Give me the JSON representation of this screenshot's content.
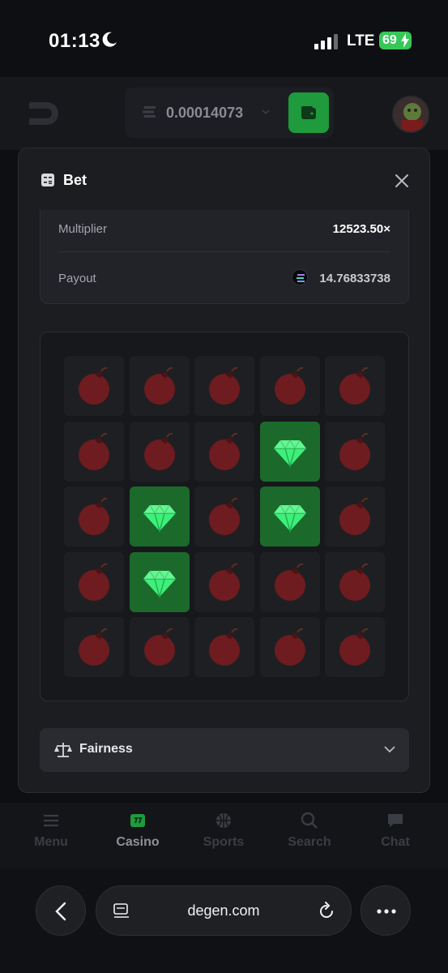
{
  "status_bar": {
    "time": "01:13",
    "network": "LTE",
    "battery": "69"
  },
  "header": {
    "balance": "0.00014073"
  },
  "modal": {
    "title": "Bet",
    "multiplier_label": "Multiplier",
    "multiplier_value": "12523.50×",
    "payout_label": "Payout",
    "payout_value": "14.76833738",
    "fairness_label": "Fairness"
  },
  "board": {
    "cells": [
      "bomb",
      "bomb",
      "bomb",
      "bomb",
      "bomb",
      "bomb",
      "bomb",
      "bomb",
      "gem",
      "bomb",
      "bomb",
      "gem",
      "bomb",
      "gem",
      "bomb",
      "bomb",
      "gem",
      "bomb",
      "bomb",
      "bomb",
      "bomb",
      "bomb",
      "bomb",
      "bomb",
      "bomb"
    ]
  },
  "bottom_nav": [
    {
      "label": "Menu",
      "icon": "menu-icon"
    },
    {
      "label": "Casino",
      "icon": "casino-icon",
      "active": true
    },
    {
      "label": "Sports",
      "icon": "sports-icon"
    },
    {
      "label": "Search",
      "icon": "search-icon"
    },
    {
      "label": "Chat",
      "icon": "chat-icon"
    }
  ],
  "browser": {
    "url": "degen.com"
  },
  "colors": {
    "gem_tile": "#1b6a2b",
    "bomb": "#6e1c1f",
    "accent": "#1f9a3c",
    "gem": "#3ef07a"
  }
}
